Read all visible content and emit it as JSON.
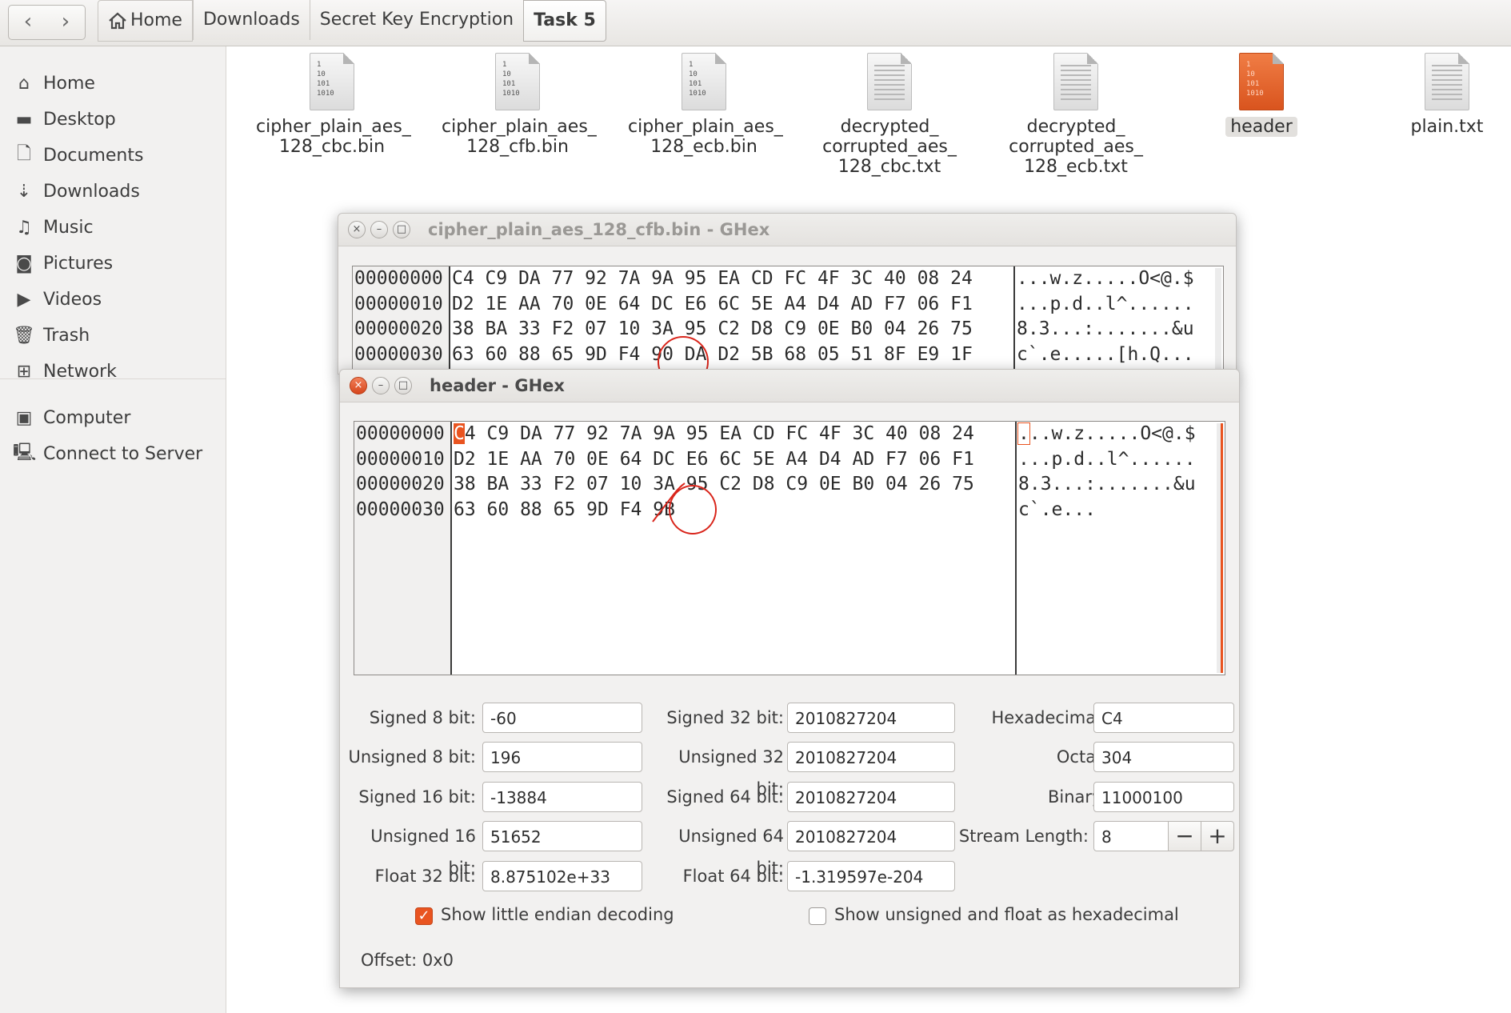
{
  "nav": {
    "back_icon": "‹",
    "forward_icon": "›"
  },
  "breadcrumb": [
    "Home",
    "Downloads",
    "Secret Key Encryption",
    "Task 5"
  ],
  "sidebar": {
    "items": [
      {
        "label": "Home",
        "icon": "home-icon"
      },
      {
        "label": "Desktop",
        "icon": "folder-icon"
      },
      {
        "label": "Documents",
        "icon": "document-icon"
      },
      {
        "label": "Downloads",
        "icon": "download-icon"
      },
      {
        "label": "Music",
        "icon": "music-icon"
      },
      {
        "label": "Pictures",
        "icon": "camera-icon"
      },
      {
        "label": "Videos",
        "icon": "video-icon"
      },
      {
        "label": "Trash",
        "icon": "trash-icon"
      },
      {
        "label": "Network",
        "icon": "network-icon"
      },
      {
        "label": "Computer",
        "icon": "computer-icon"
      },
      {
        "label": "Connect to Server",
        "icon": "server-icon"
      }
    ]
  },
  "files": [
    {
      "name_lines": [
        "cipher_plain_aes_",
        "128_cbc.bin"
      ],
      "type": "binary"
    },
    {
      "name_lines": [
        "cipher_plain_aes_",
        "128_cfb.bin"
      ],
      "type": "binary"
    },
    {
      "name_lines": [
        "cipher_plain_aes_",
        "128_ecb.bin"
      ],
      "type": "binary"
    },
    {
      "name_lines": [
        "decrypted_",
        "corrupted_aes_",
        "128_cbc.txt"
      ],
      "type": "text"
    },
    {
      "name_lines": [
        "decrypted_",
        "corrupted_aes_",
        "128_ecb.txt"
      ],
      "type": "text"
    },
    {
      "name_lines": [
        "header"
      ],
      "type": "binary",
      "selected": true
    },
    {
      "name_lines": [
        "plain.txt"
      ],
      "type": "text"
    }
  ],
  "binary_icon_text": [
    "1",
    "10",
    "101",
    "1010"
  ],
  "ghex_back": {
    "title": "cipher_plain_aes_128_cfb.bin - GHex",
    "offsets": [
      "00000000",
      "00000010",
      "00000020",
      "00000030"
    ],
    "hex_rows": [
      "C4 C9 DA 77 92 7A 9A 95 EA CD FC 4F 3C 40 08 24",
      "D2 1E AA 70 0E 64 DC E6 6C 5E A4 D4 AD F7 06 F1",
      "38 BA 33 F2 07 10 3A 95 C2 D8 C9 0E B0 04 26 75",
      "63 60 88 65 9D F4 90 DA D2 5B 68 05 51 8F E9 1F"
    ],
    "ascii_rows": [
      "...w.z.....O<@.$",
      "...p.d..l^......",
      "8.3...:.......&u",
      "c`.e.....[h.Q..."
    ]
  },
  "ghex_front": {
    "title": "header - GHex",
    "offsets": [
      "00000000",
      "00000010",
      "00000020",
      "00000030"
    ],
    "hex_rows": [
      "C4 C9 DA 77 92 7A 9A 95 EA CD FC 4F 3C 40 08 24",
      "D2 1E AA 70 0E 64 DC E6 6C 5E A4 D4 AD F7 06 F1",
      "38 BA 33 F2 07 10 3A 95 C2 D8 C9 0E B0 04 26 75",
      "63 60 88 65 9D F4 9B"
    ],
    "ascii_rows": [
      "...w.z.....O<@.$",
      "...p.d..l^......",
      "8.3...:.......&u",
      "c`.e..."
    ],
    "converter": {
      "signed_8_label": "Signed 8 bit:",
      "signed_8": "-60",
      "unsigned_8_label": "Unsigned 8 bit:",
      "unsigned_8": "196",
      "signed_16_label": "Signed 16 bit:",
      "signed_16": "-13884",
      "unsigned_16_label": "Unsigned 16 bit:",
      "unsigned_16": "51652",
      "float_32_label": "Float 32 bit:",
      "float_32": "8.875102e+33",
      "signed_32_label": "Signed 32 bit:",
      "signed_32": "2010827204",
      "unsigned_32_label": "Unsigned 32 bit:",
      "unsigned_32": "2010827204",
      "signed_64_label": "Signed 64 bit:",
      "signed_64": "2010827204",
      "unsigned_64_label": "Unsigned 64 bit:",
      "unsigned_64": "2010827204",
      "float_64_label": "Float 64 bit:",
      "float_64": "-1.319597e-204",
      "hex_label": "Hexadecimal:",
      "hex": "C4",
      "octal_label": "Octal:",
      "octal": "304",
      "binary_label": "Binary:",
      "binary": "11000100",
      "stream_label": "Stream Length:",
      "stream": "8",
      "minus": "−",
      "plus": "+"
    },
    "little_endian_label": "Show little endian decoding",
    "little_endian_checked": true,
    "unsigned_hex_label": "Show unsigned and float as hexadecimal",
    "unsigned_hex_checked": false,
    "offset_status": "Offset: 0x0"
  },
  "colors": {
    "accent": "#e95420",
    "annotation": "#d9261c"
  }
}
